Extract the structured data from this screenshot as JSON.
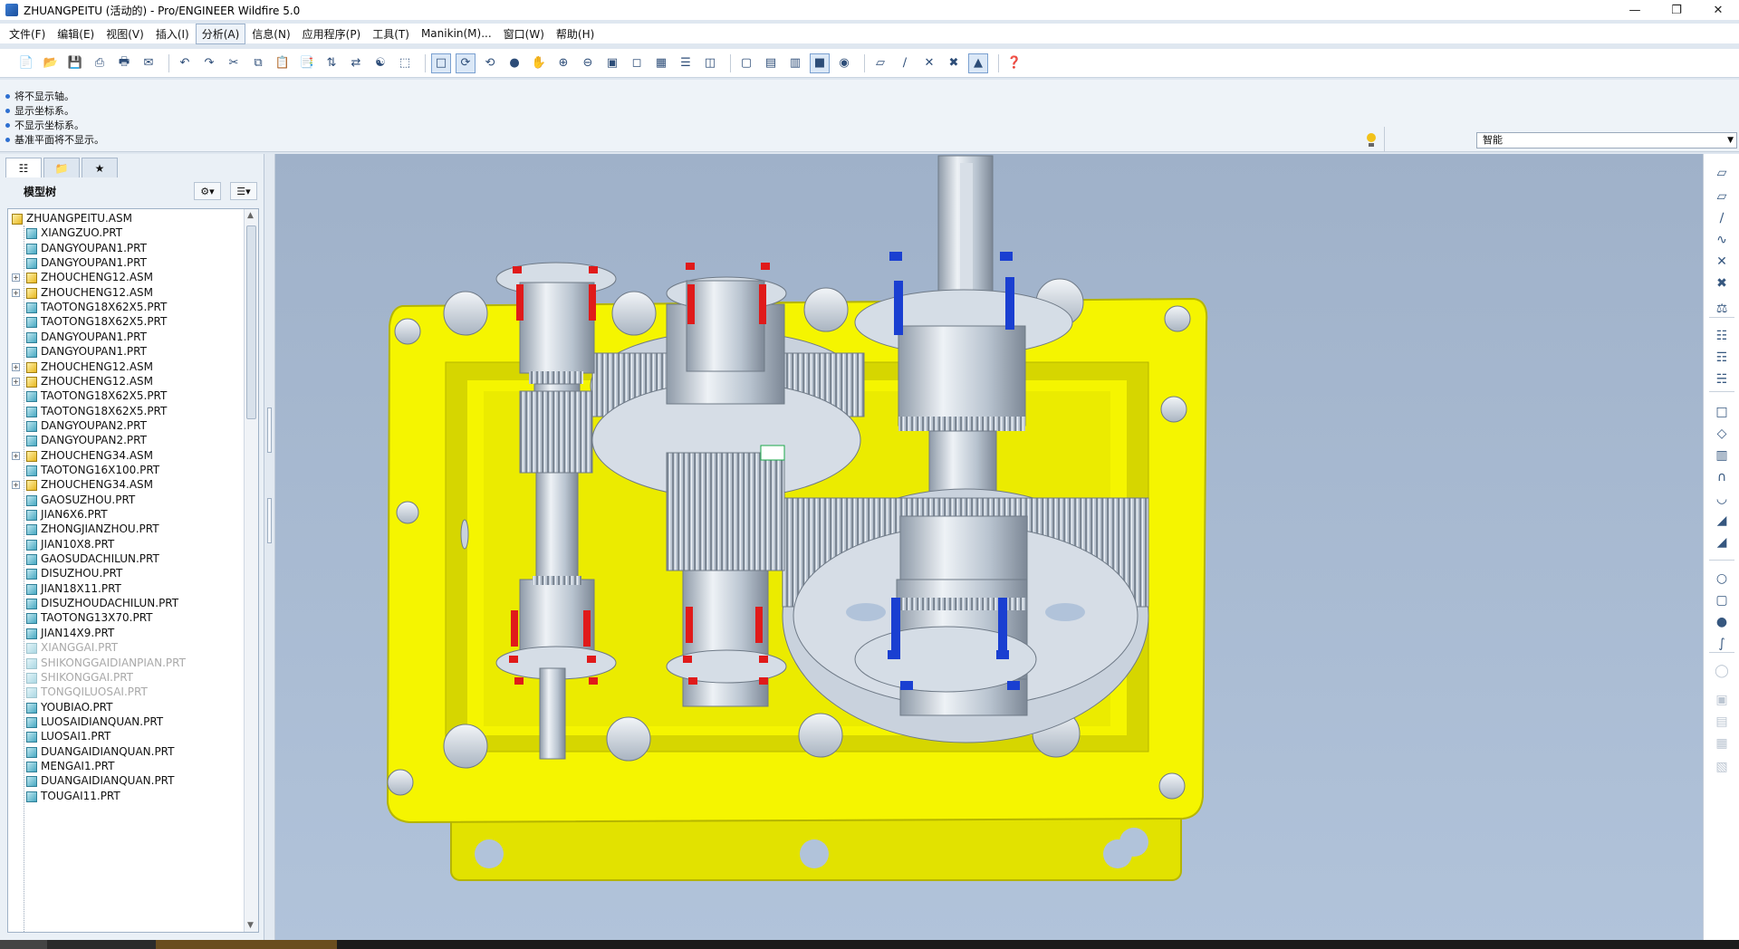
{
  "window": {
    "title": "ZHUANGPEITU (活动的) - Pro/ENGINEER Wildfire 5.0",
    "controls": [
      "minimize-icon",
      "restore-icon",
      "close-icon"
    ]
  },
  "menubar": {
    "items": [
      {
        "label": "文件(F)"
      },
      {
        "label": "编辑(E)"
      },
      {
        "label": "视图(V)"
      },
      {
        "label": "插入(I)"
      },
      {
        "label": "分析(A)",
        "active": true
      },
      {
        "label": "信息(N)"
      },
      {
        "label": "应用程序(P)"
      },
      {
        "label": "工具(T)"
      },
      {
        "label": "Manikin(M)..."
      },
      {
        "label": "窗口(W)"
      },
      {
        "label": "帮助(H)"
      }
    ]
  },
  "toolbar": {
    "groups": [
      [
        "new-file-icon",
        "open-file-icon",
        "save-icon",
        "print-icon",
        "quick-print-icon",
        "email-icon"
      ],
      [
        "undo-icon",
        "redo-icon",
        "cut-icon",
        "copy-icon",
        "paste-icon",
        "paste-special-icon",
        "regenerate-icon",
        "regen-manager-icon",
        "find-icon",
        "select-box-icon"
      ],
      [
        "repaint-icon",
        "spin-center-icon",
        "orient-mode-icon",
        "appearance-gallery-icon",
        "pan-icon",
        "zoom-in-icon",
        "zoom-out-icon",
        "refit-icon",
        "reorient-icon",
        "saved-views-icon",
        "layers-icon",
        "view-manager-icon"
      ],
      [
        "wireframe-icon",
        "hidden-line-icon",
        "no-hidden-icon",
        "shading-icon",
        "enhanced-realism-icon"
      ],
      [
        "datum-planes-icon",
        "datum-axes-icon",
        "datum-points-icon",
        "coordinate-systems-icon",
        "annotations-icon"
      ],
      [
        "context-help-icon"
      ]
    ],
    "selected": [
      "spin-center-icon",
      "shading-icon",
      "annotations-icon",
      "repaint-icon"
    ]
  },
  "messages": [
    "将不显示轴。",
    "显示坐标系。",
    "不显示坐标系。",
    "基准平面将不显示。"
  ],
  "filter": {
    "value": "智能"
  },
  "left_panel": {
    "tabs": [
      "model-tree-tab-icon",
      "folder-browser-tab-icon",
      "favorites-tab-icon"
    ],
    "header_label": "模型树",
    "settings_icon": "tree-settings-icon",
    "show_icon": "tree-show-icon",
    "root": "ZHUANGPEITU.ASM",
    "items": [
      {
        "label": "XIANGZUO.PRT",
        "type": "part"
      },
      {
        "label": "DANGYOUPAN1.PRT",
        "type": "part"
      },
      {
        "label": "DANGYOUPAN1.PRT",
        "type": "part"
      },
      {
        "label": "ZHOUCHENG12.ASM",
        "type": "asm",
        "expandable": true
      },
      {
        "label": "ZHOUCHENG12.ASM",
        "type": "asm",
        "expandable": true
      },
      {
        "label": "TAOTONG18X62X5.PRT",
        "type": "part"
      },
      {
        "label": "TAOTONG18X62X5.PRT",
        "type": "part"
      },
      {
        "label": "DANGYOUPAN1.PRT",
        "type": "part"
      },
      {
        "label": "DANGYOUPAN1.PRT",
        "type": "part"
      },
      {
        "label": "ZHOUCHENG12.ASM",
        "type": "asm",
        "expandable": true
      },
      {
        "label": "ZHOUCHENG12.ASM",
        "type": "asm",
        "expandable": true
      },
      {
        "label": "TAOTONG18X62X5.PRT",
        "type": "part"
      },
      {
        "label": "TAOTONG18X62X5.PRT",
        "type": "part"
      },
      {
        "label": "DANGYOUPAN2.PRT",
        "type": "part"
      },
      {
        "label": "DANGYOUPAN2.PRT",
        "type": "part"
      },
      {
        "label": "ZHOUCHENG34.ASM",
        "type": "asm",
        "expandable": true
      },
      {
        "label": "TAOTONG16X100.PRT",
        "type": "part"
      },
      {
        "label": "ZHOUCHENG34.ASM",
        "type": "asm",
        "expandable": true
      },
      {
        "label": "GAOSUZHOU.PRT",
        "type": "part"
      },
      {
        "label": "JIAN6X6.PRT",
        "type": "part"
      },
      {
        "label": "ZHONGJIANZHOU.PRT",
        "type": "part"
      },
      {
        "label": "JIAN10X8.PRT",
        "type": "part"
      },
      {
        "label": "GAOSUDACHILUN.PRT",
        "type": "part"
      },
      {
        "label": "DISUZHOU.PRT",
        "type": "part"
      },
      {
        "label": "JIAN18X11.PRT",
        "type": "part"
      },
      {
        "label": "DISUZHOUDACHILUN.PRT",
        "type": "part"
      },
      {
        "label": "TAOTONG13X70.PRT",
        "type": "part"
      },
      {
        "label": "JIAN14X9.PRT",
        "type": "part"
      },
      {
        "label": "XIANGGAI.PRT",
        "type": "part",
        "hidden": true
      },
      {
        "label": "SHIKONGGAIDIANPIAN.PRT",
        "type": "part",
        "hidden": true
      },
      {
        "label": "SHIKONGGAI.PRT",
        "type": "part",
        "hidden": true
      },
      {
        "label": "TONGQILUOSAI.PRT",
        "type": "part",
        "hidden": true
      },
      {
        "label": "YOUBIAO.PRT",
        "type": "part"
      },
      {
        "label": "LUOSAIDIANQUAN.PRT",
        "type": "part"
      },
      {
        "label": "LUOSAI1.PRT",
        "type": "part"
      },
      {
        "label": "DUANGAIDIANQUAN.PRT",
        "type": "part"
      },
      {
        "label": "MENGAI1.PRT",
        "type": "part"
      },
      {
        "label": "DUANGAIDIANQUAN.PRT",
        "type": "part"
      },
      {
        "label": "TOUGAI11.PRT",
        "type": "part"
      }
    ]
  },
  "right_toolbar": {
    "items": [
      "datum-plane-icon",
      "datum-plane-create-icon",
      "datum-axis-icon",
      "sketched-curve-icon",
      "datum-point-icon",
      "datum-csys-icon",
      "analysis-feature-icon",
      "assemble-icon",
      "create-component-icon",
      "package-icon",
      "repeat-component-icon",
      "mirror-icon",
      "pattern-icon",
      "cut-feature-icon",
      "round-icon",
      "chamfer-icon",
      "draft-icon",
      "hole-icon",
      "shell-icon",
      "rib-icon",
      "sweep-icon",
      "blend-icon",
      "merge-icon",
      "trim-icon",
      "extend-icon",
      "offset-icon"
    ],
    "dim_from": 13
  },
  "colors": {
    "housing": "#f5f500",
    "shaft": "#c9d3df",
    "bolt_red": "#e01a1a",
    "bolt_blue": "#1a3fd1",
    "background_top": "#9fb1c9",
    "background_bottom": "#b1c3da"
  }
}
